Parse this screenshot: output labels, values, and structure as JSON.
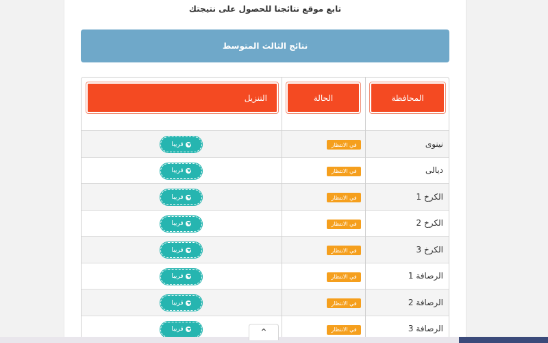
{
  "page": {
    "subtitle": "تابع موقع نتائجنا للحصول على نتيجتك",
    "banner": "نتائج الثالث المتوسط"
  },
  "table": {
    "headers": {
      "governorate": "المحافظة",
      "status": "الحالة",
      "download": "التنزيل"
    },
    "rows": [
      {
        "governorate": "نينوى",
        "status": "في الانتظار",
        "action": "قريبا"
      },
      {
        "governorate": "ديالى",
        "status": "في الانتظار",
        "action": "قريبا"
      },
      {
        "governorate": "الكرخ 1",
        "status": "في الانتظار",
        "action": "قريبا"
      },
      {
        "governorate": "الكرخ 2",
        "status": "في الانتظار",
        "action": "قريبا"
      },
      {
        "governorate": "الكرخ 3",
        "status": "في الانتظار",
        "action": "قريبا"
      },
      {
        "governorate": "الرصافة 1",
        "status": "في الانتظار",
        "action": "قريبا"
      },
      {
        "governorate": "الرصافة 2",
        "status": "في الانتظار",
        "action": "قريبا"
      },
      {
        "governorate": "الرصافة 3",
        "status": "في الانتظار",
        "action": "قريبا"
      }
    ]
  },
  "colors": {
    "banner": "#6fa8c9",
    "header_button": "#f44a22",
    "status_badge": "#f59f1d",
    "soon_button": "#26b5b0"
  },
  "icons": {
    "soon": "download-circle-icon",
    "scroll_top": "chevron-up-icon"
  },
  "scroll_top_glyph": "⌃"
}
